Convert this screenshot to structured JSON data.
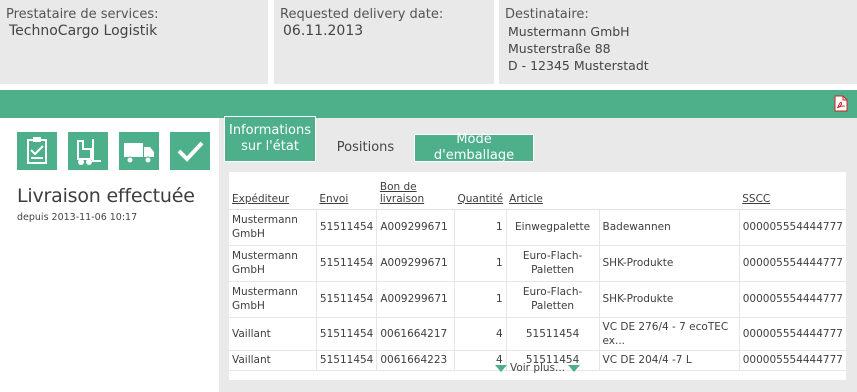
{
  "header": {
    "provider": {
      "label": "Prestataire de services:",
      "value": "TechnoCargo Logistik"
    },
    "delivery_date": {
      "label": "Requested delivery date:",
      "value": "06.11.2013"
    },
    "recipient": {
      "label": "Destinataire:",
      "lines": [
        "Mustermann GmbH",
        "Musterstraße 88",
        "D - 12345 Musterstadt"
      ]
    }
  },
  "status": {
    "title": "Livraison effectuée",
    "since": "depuis 2013-11-06 10:17",
    "icons": [
      "clipboard-check-icon",
      "forklift-icon",
      "truck-icon",
      "checkmark-icon"
    ]
  },
  "tabs": [
    {
      "label": "Informations sur l'état",
      "active": false
    },
    {
      "label": "Positions",
      "active": true
    },
    {
      "label": "Mode d'emballage",
      "active": false
    }
  ],
  "table": {
    "columns": [
      "Expéditeur",
      "Envoi",
      "Bon de livraison",
      "Quantité",
      "Article",
      "SSCC"
    ],
    "rows": [
      {
        "sender": "Mustermann GmbH",
        "shipment": "51511454",
        "delivery_note": "A009299671",
        "qty": "1",
        "article_code": "Einwegpalette",
        "article_name": "Badewannen",
        "sscc": "000005554444777"
      },
      {
        "sender": "Mustermann GmbH",
        "shipment": "51511454",
        "delivery_note": "A009299671",
        "qty": "1",
        "article_code": "Euro-Flach-Paletten",
        "article_name": "SHK-Produkte",
        "sscc": "000005554444777"
      },
      {
        "sender": "Mustermann GmbH",
        "shipment": "51511454",
        "delivery_note": "A009299671",
        "qty": "1",
        "article_code": "Euro-Flach-Paletten",
        "article_name": "SHK-Produkte",
        "sscc": "000005554444777"
      },
      {
        "sender": "Vaillant",
        "shipment": "51511454",
        "delivery_note": "0061664217",
        "qty": "4",
        "article_code": "51511454",
        "article_name": "VC DE 276/4 - 7 ecoTEC ex...",
        "sscc": "000005554444777"
      },
      {
        "sender": "Vaillant",
        "shipment": "51511454",
        "delivery_note": "0061664223",
        "qty": "4",
        "article_code": "51511454",
        "article_name": "VC DE 204/4 -7 L",
        "sscc": "000005554444777"
      }
    ],
    "more_label": "Voir plus..."
  },
  "colors": {
    "accent": "#4db08a",
    "panel": "#e9e9e9"
  }
}
